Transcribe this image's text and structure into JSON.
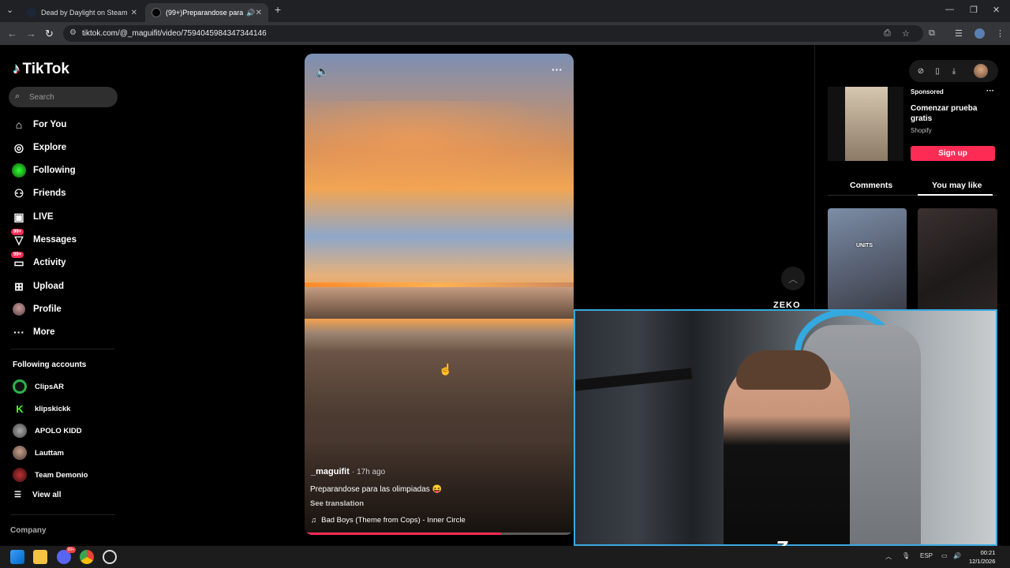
{
  "browser": {
    "tabs": [
      {
        "title": "Dead by Daylight on Steam",
        "active": false
      },
      {
        "title": "(99+)Preparandose para las",
        "active": true
      }
    ],
    "url": "tiktok.com/@_maguifit/video/7594045984347344146"
  },
  "sidebar": {
    "logo": "TikTok",
    "search_placeholder": "Search",
    "nav": [
      {
        "label": "For You",
        "icon": "home-icon"
      },
      {
        "label": "Explore",
        "icon": "compass-icon"
      },
      {
        "label": "Following",
        "icon": "following-avatar-icon"
      },
      {
        "label": "Friends",
        "icon": "friends-icon"
      },
      {
        "label": "LIVE",
        "icon": "live-icon"
      },
      {
        "label": "Messages",
        "icon": "messages-icon",
        "badge": "99+"
      },
      {
        "label": "Activity",
        "icon": "activity-icon",
        "badge": "99+"
      },
      {
        "label": "Upload",
        "icon": "upload-icon"
      },
      {
        "label": "Profile",
        "icon": "profile-avatar-icon"
      },
      {
        "label": "More",
        "icon": "more-icon"
      }
    ],
    "following_title": "Following accounts",
    "accounts": [
      {
        "name": "ClipsAR",
        "color": "#2bb34a"
      },
      {
        "name": "klipskickk",
        "color": "#53fc18"
      },
      {
        "name": "APOLO KIDD",
        "color": "#777777"
      },
      {
        "name": "Lauttam",
        "color": "#8a6d5e"
      },
      {
        "name": "Team Demonio",
        "color": "#6b1f2a"
      }
    ],
    "view_all": "View all",
    "company": "Company"
  },
  "video": {
    "author": "_maguifit",
    "time": "· 17h ago",
    "description": "Preparandose para las olimpiadas 😝",
    "see_translation": "See translation",
    "music": "Bad Boys (Theme from Cops) - Inner Circle",
    "progress": 0.73
  },
  "right": {
    "sponsored": "Sponsored",
    "ad_title": "Comenzar prueba gratis",
    "ad_brand": "Shopify",
    "signup": "Sign up",
    "tabs": [
      "Comments",
      "You may like"
    ],
    "thumb_text": "UNITS"
  },
  "stream": {
    "brand": "ZEKO",
    "logo_letter": "Z"
  },
  "taskbar": {
    "lang": "ESP",
    "time": "00:21",
    "date": "12/1/2026",
    "discord_badge": "99+"
  },
  "colors": {
    "accent": "#fe2c55",
    "webcam_border": "#3aa9df"
  }
}
